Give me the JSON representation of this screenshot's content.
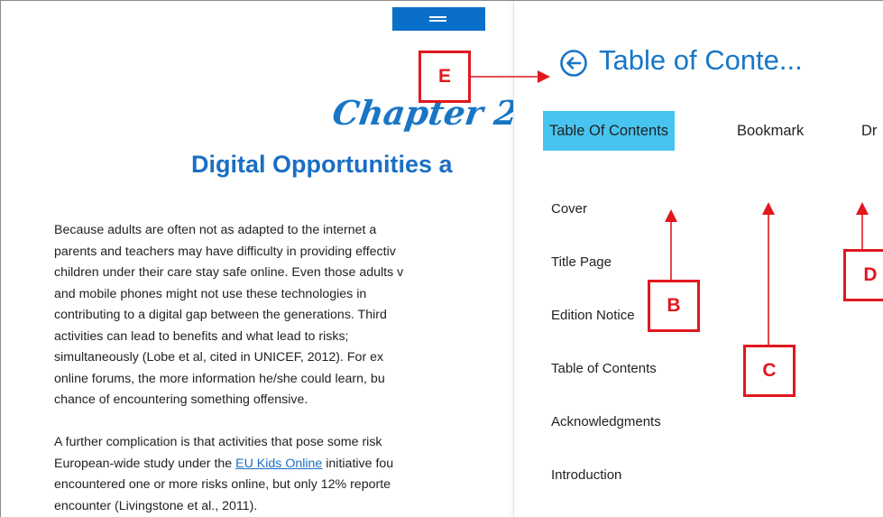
{
  "reader": {
    "chapter_title": "Chapter 2",
    "chapter_subtitle": "Digital Opportunities a",
    "paragraph1_lines": [
      "Because adults are often not as adapted to the internet a",
      "parents and teachers may have difficulty in providing effectiv",
      "children under their care stay safe online. Even those adults v",
      "and mobile phones might not use these technologies in",
      "contributing to a digital gap between the generations. Third",
      "activities can lead to benefits and what lead to risks;",
      "simultaneously (Lobe et al, cited in UNICEF, 2012). For ex",
      "online forums, the more information he/she could learn, bu",
      "chance of encountering something offensive."
    ],
    "paragraph2": {
      "line1": "A further complication is that activities that pose some risk",
      "line2_before": "European-wide study under the ",
      "line2_link": "EU Kids Online",
      "line2_after": " initiative fou",
      "line3": "encountered one or more risks online, but only 12% reporte",
      "line4": "encounter (Livingstone et al., 2011)."
    }
  },
  "panel": {
    "title": "Table of Conte...",
    "tabs": [
      {
        "label": "Table Of Contents",
        "active": true
      },
      {
        "label": "Bookmark",
        "active": false
      },
      {
        "label": "Dr",
        "active": false
      }
    ],
    "toc_items": [
      "Cover",
      "Title Page",
      "Edition Notice",
      "Table of Contents",
      "Acknowledgments",
      "Introduction"
    ]
  },
  "annotations": {
    "labels": [
      "E",
      "B",
      "C",
      "D"
    ],
    "color": "#e1171e"
  },
  "colors": {
    "accent": "#1976c6",
    "active_tab": "#48c4f1",
    "handle": "#0a6fc9"
  }
}
